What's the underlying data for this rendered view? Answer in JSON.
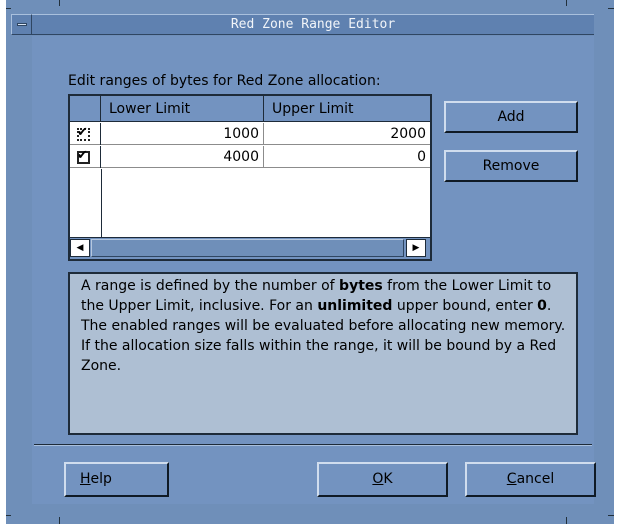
{
  "window": {
    "title": "Red Zone Range Editor",
    "menu_icon": "window-menu-icon"
  },
  "prompt": "Edit ranges of bytes for Red Zone allocation:",
  "table": {
    "headers": [
      "",
      "Lower Limit",
      "Upper Limit"
    ],
    "rows": [
      {
        "enabled": true,
        "lower": "1000",
        "upper": "2000"
      },
      {
        "enabled": true,
        "lower": "4000",
        "upper": "0"
      }
    ],
    "check_glyph": "✔",
    "scroll_left_glyph": "◀",
    "scroll_right_glyph": "▶"
  },
  "buttons": {
    "add": "Add",
    "remove": "Remove",
    "help": "Help",
    "ok": "OK",
    "cancel": "Cancel"
  },
  "description": {
    "p1": "A range is defined by the number of ",
    "b1": "bytes",
    "p2": " from the Lower Limit to the Upper Limit, inclusive. For an ",
    "b2": "unlimited",
    "p3": " upper bound, enter ",
    "b3": "0",
    "p4": ". The enabled ranges will be evaluated before allocating new memory. If the allocation size falls within the range, it will be bound by a Red Zone."
  },
  "colors": {
    "dialog_bg": "#7393c0",
    "info_bg": "#aebfd3",
    "frame": "#6f8fb9"
  }
}
